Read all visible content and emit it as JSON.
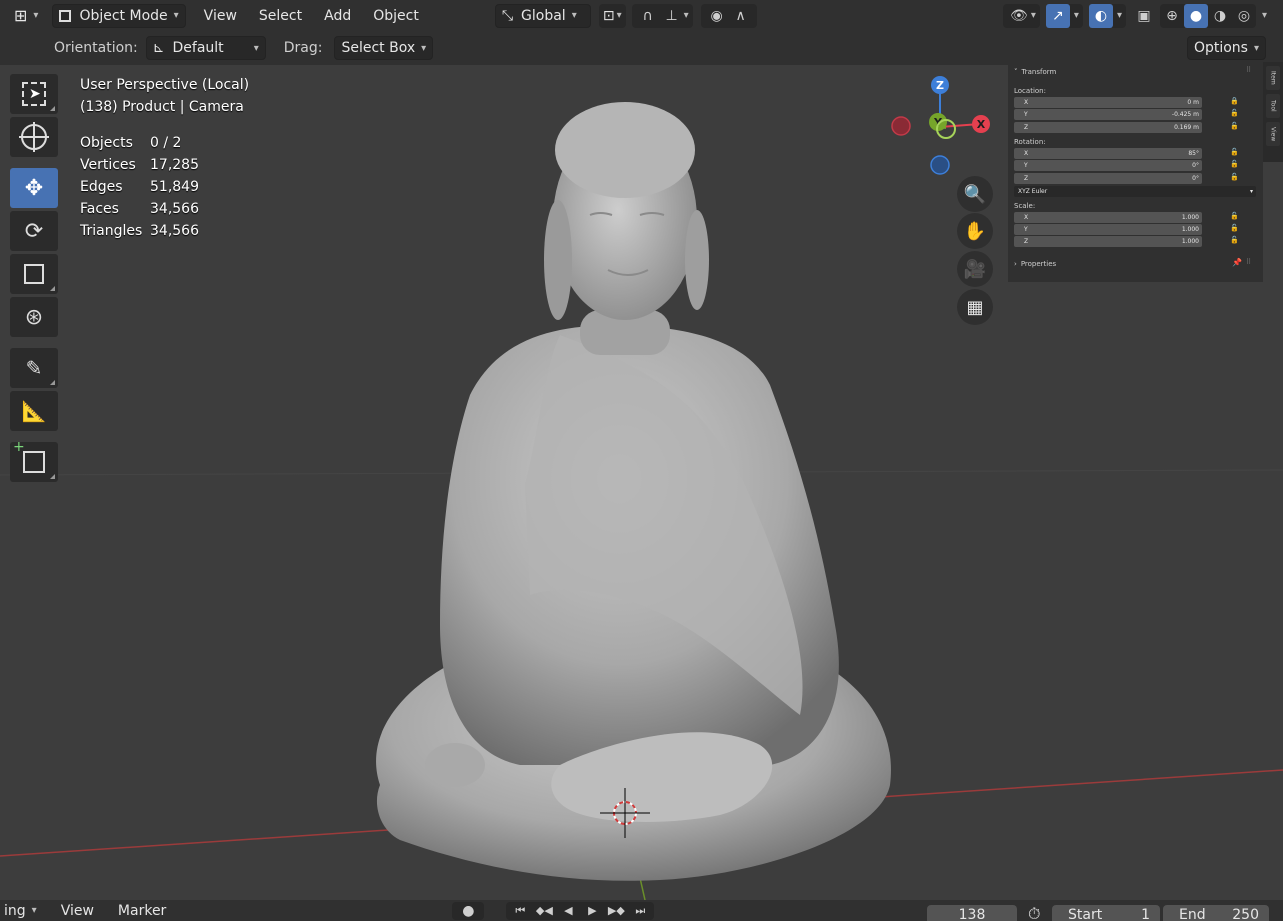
{
  "header": {
    "mode_label": "Object Mode",
    "menus": [
      "View",
      "Select",
      "Add",
      "Object"
    ],
    "transform_orientation": "Global"
  },
  "subheader": {
    "orientation_label": "Orientation:",
    "orientation_value": "Default",
    "drag_label": "Drag:",
    "drag_value": "Select Box",
    "options_label": "Options"
  },
  "overlay": {
    "perspective": "User Perspective (Local)",
    "context": "(138) Product | Camera",
    "stats": [
      {
        "label": "Objects",
        "value": "0 / 2"
      },
      {
        "label": "Vertices",
        "value": "17,285"
      },
      {
        "label": "Edges",
        "value": "51,849"
      },
      {
        "label": "Faces",
        "value": "34,566"
      },
      {
        "label": "Triangles",
        "value": "34,566"
      }
    ]
  },
  "gizmo": {
    "z": "Z",
    "y": "Y",
    "x": "X"
  },
  "npanel": {
    "section_transform": "Transform",
    "location_label": "Location:",
    "location": [
      {
        "axis": "X",
        "value": "0 m"
      },
      {
        "axis": "Y",
        "value": "-0.425 m"
      },
      {
        "axis": "Z",
        "value": "0.169 m"
      }
    ],
    "rotation_label": "Rotation:",
    "rotation": [
      {
        "axis": "X",
        "value": "85°"
      },
      {
        "axis": "Y",
        "value": "0°"
      },
      {
        "axis": "Z",
        "value": "0°"
      }
    ],
    "rotation_mode": "XYZ Euler",
    "scale_label": "Scale:",
    "scale": [
      {
        "axis": "X",
        "value": "1.000"
      },
      {
        "axis": "Y",
        "value": "1.000"
      },
      {
        "axis": "Z",
        "value": "1.000"
      }
    ],
    "section_properties": "Properties",
    "tabs": [
      "Item",
      "Tool",
      "View"
    ]
  },
  "timeline": {
    "playback_partial": "ing",
    "view": "View",
    "marker": "Marker",
    "current_frame": "138",
    "start_label": "Start",
    "start_value": "1",
    "end_label": "End",
    "end_value": "250"
  },
  "colors": {
    "accent": "#4772b3",
    "axis_x": "#e5404f",
    "axis_y": "#76a52a",
    "axis_z": "#3d7fd9"
  }
}
